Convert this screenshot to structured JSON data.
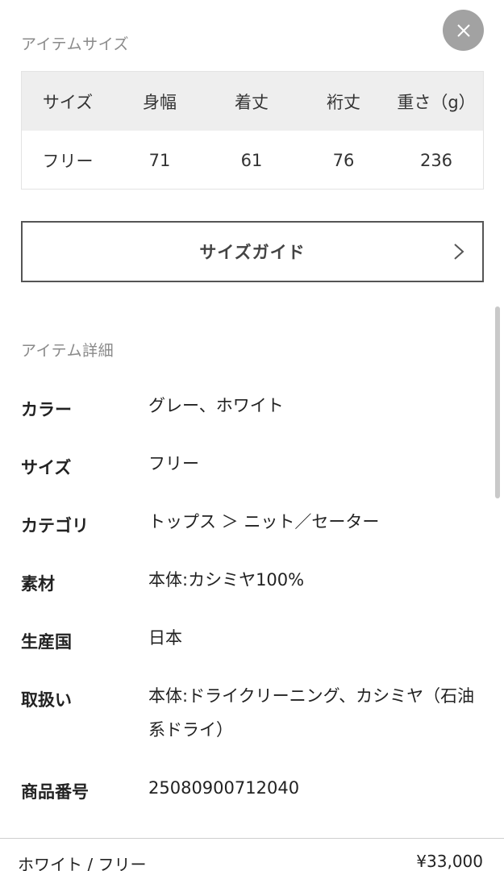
{
  "item_size": {
    "section_title": "アイテムサイズ",
    "headers": [
      "サイズ",
      "身幅",
      "着丈",
      "裄丈",
      "重さ（g）"
    ],
    "rows": [
      [
        "フリー",
        "71",
        "61",
        "76",
        "236"
      ]
    ]
  },
  "size_guide": {
    "label": "サイズガイド"
  },
  "item_details": {
    "section_title": "アイテム詳細",
    "rows": [
      {
        "label": "カラー",
        "value": "グレー、ホワイト"
      },
      {
        "label": "サイズ",
        "value": "フリー"
      },
      {
        "label": "カテゴリ",
        "value": "トップス ＞ ニット／セーター"
      },
      {
        "label": "素材",
        "value": "本体:カシミヤ100%"
      },
      {
        "label": "生産国",
        "value": "日本"
      },
      {
        "label": "取扱い",
        "value": "本体:ドライクリーニング、カシミヤ（石油系ドライ）"
      },
      {
        "label": "商品番号",
        "value": "25080900712040"
      }
    ]
  },
  "footer": {
    "variant": "ホワイト / フリー",
    "price": "¥33,000"
  },
  "colors": {
    "close_button_bg": "#a2a2a2",
    "table_header_bg": "#eeeeee",
    "button_border": "#555555"
  },
  "icons": {
    "close": "close-icon",
    "guide_arrow": "chevron-right-icon"
  }
}
